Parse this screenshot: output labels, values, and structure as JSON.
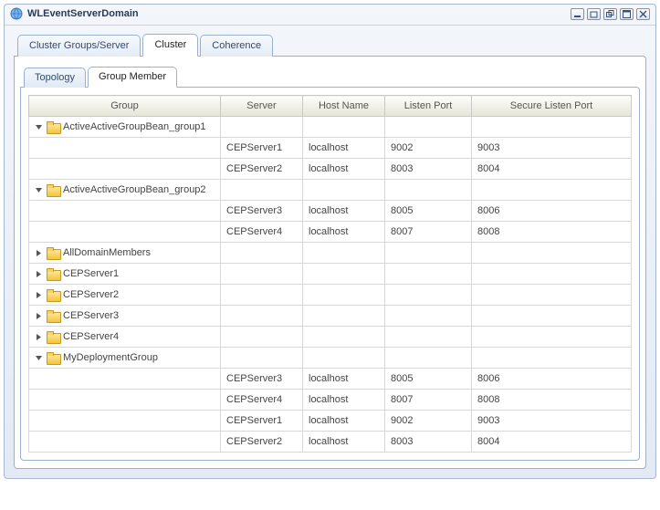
{
  "header": {
    "title": "WLEventServerDomain"
  },
  "tabs": {
    "items": [
      {
        "label": "Cluster Groups/Server",
        "active": false
      },
      {
        "label": "Cluster",
        "active": true
      },
      {
        "label": "Coherence",
        "active": false
      }
    ]
  },
  "subtabs": {
    "items": [
      {
        "label": "Topology",
        "active": false
      },
      {
        "label": "Group Member",
        "active": true
      }
    ]
  },
  "table": {
    "columns": {
      "group": "Group",
      "server": "Server",
      "hostname": "Host Name",
      "listen": "Listen Port",
      "secure_listen": "Secure Listen Port"
    },
    "rows": [
      {
        "type": "group",
        "expanded": true,
        "name": "ActiveActiveGroupBean_group1"
      },
      {
        "type": "member",
        "server": "CEPServer1",
        "host": "localhost",
        "listen": "9002",
        "secure": "9003"
      },
      {
        "type": "member",
        "server": "CEPServer2",
        "host": "localhost",
        "listen": "8003",
        "secure": "8004"
      },
      {
        "type": "group",
        "expanded": true,
        "name": "ActiveActiveGroupBean_group2"
      },
      {
        "type": "member",
        "server": "CEPServer3",
        "host": "localhost",
        "listen": "8005",
        "secure": "8006"
      },
      {
        "type": "member",
        "server": "CEPServer4",
        "host": "localhost",
        "listen": "8007",
        "secure": "8008"
      },
      {
        "type": "group",
        "expanded": false,
        "name": "AllDomainMembers"
      },
      {
        "type": "group",
        "expanded": false,
        "name": "CEPServer1"
      },
      {
        "type": "group",
        "expanded": false,
        "name": "CEPServer2"
      },
      {
        "type": "group",
        "expanded": false,
        "name": "CEPServer3"
      },
      {
        "type": "group",
        "expanded": false,
        "name": "CEPServer4"
      },
      {
        "type": "group",
        "expanded": true,
        "name": "MyDeploymentGroup"
      },
      {
        "type": "member",
        "server": "CEPServer3",
        "host": "localhost",
        "listen": "8005",
        "secure": "8006"
      },
      {
        "type": "member",
        "server": "CEPServer4",
        "host": "localhost",
        "listen": "8007",
        "secure": "8008"
      },
      {
        "type": "member",
        "server": "CEPServer1",
        "host": "localhost",
        "listen": "9002",
        "secure": "9003"
      },
      {
        "type": "member",
        "server": "CEPServer2",
        "host": "localhost",
        "listen": "8003",
        "secure": "8004"
      }
    ]
  }
}
